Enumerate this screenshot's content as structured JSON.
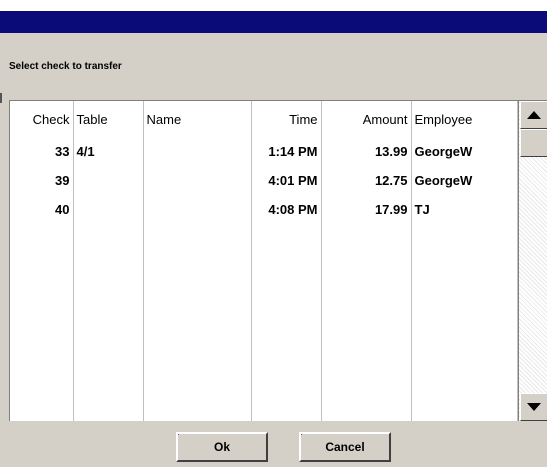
{
  "dialog": {
    "prompt": "Select check to transfer"
  },
  "columns": [
    "Check",
    "Table",
    "Name",
    "Time",
    "Amount",
    "Employee"
  ],
  "rows": [
    {
      "check": "33",
      "table": "4/1",
      "name": "",
      "time": "1:14 PM",
      "amount": "13.99",
      "employee": "GeorgeW"
    },
    {
      "check": "39",
      "table": "",
      "name": "",
      "time": "4:01 PM",
      "amount": "12.75",
      "employee": "GeorgeW"
    },
    {
      "check": "40",
      "table": "",
      "name": "",
      "time": "4:08 PM",
      "amount": "17.99",
      "employee": "TJ"
    }
  ],
  "scrollbar": {
    "up_icon": "triangle-up",
    "down_icon": "triangle-down"
  },
  "buttons": {
    "ok": "Ok",
    "cancel": "Cancel"
  },
  "colors": {
    "titlebar": "#0a0a78",
    "dialog_bg": "#d4d0c8",
    "grid_bg": "#ffffff"
  }
}
